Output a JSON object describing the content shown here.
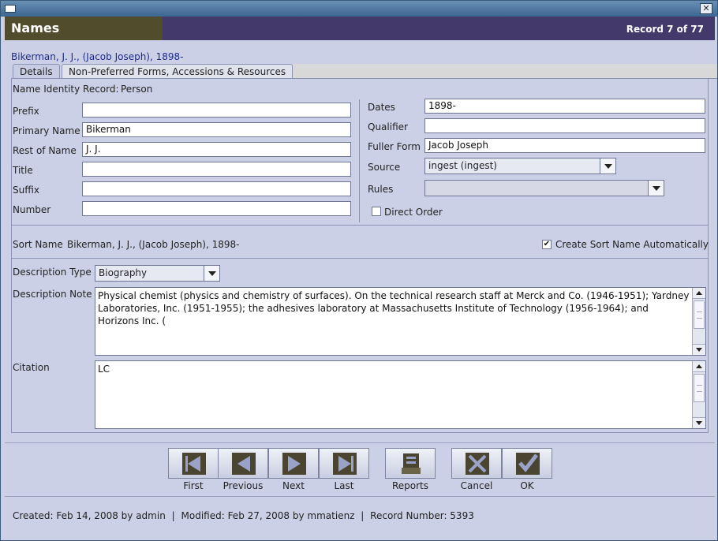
{
  "window": {
    "close_glyph": "✕"
  },
  "header": {
    "title": "Names",
    "record": "Record 7 of 77"
  },
  "record_heading": "Bikerman, J. J.,  (Jacob Joseph), 1898-",
  "tabs": [
    {
      "label": "Details",
      "active": true
    },
    {
      "label": "Non-Preferred Forms, Accessions & Resources",
      "active": false
    }
  ],
  "identity": {
    "label": "Name Identity Record:",
    "value": "Person"
  },
  "left_fields": {
    "prefix": {
      "label": "Prefix",
      "value": ""
    },
    "primary_name": {
      "label": "Primary Name",
      "value": "Bikerman"
    },
    "rest_of_name": {
      "label": "Rest of Name",
      "value": "J. J."
    },
    "title": {
      "label": "Title",
      "value": ""
    },
    "suffix": {
      "label": "Suffix",
      "value": ""
    },
    "number": {
      "label": "Number",
      "value": ""
    }
  },
  "right_fields": {
    "dates": {
      "label": "Dates",
      "value": "1898-"
    },
    "qualifier": {
      "label": "Qualifier",
      "value": ""
    },
    "fuller_form": {
      "label": "Fuller Form",
      "value": "Jacob Joseph"
    },
    "source": {
      "label": "Source",
      "value": "ingest (ingest)"
    },
    "rules": {
      "label": "Rules",
      "value": ""
    },
    "direct_order": {
      "label": "Direct Order",
      "checked": false
    }
  },
  "sort_name": {
    "label": "Sort Name",
    "value": "Bikerman, J. J.,  (Jacob Joseph), 1898-",
    "auto_label": "Create Sort Name Automatically",
    "auto_checked": true,
    "check_glyph": "✔"
  },
  "description_type": {
    "label": "Description Type",
    "value": "Biography"
  },
  "description_note": {
    "label": "Description Note",
    "value": "Physical chemist (physics and chemistry of surfaces).  On the technical research staff at Merck and Co. (1946-1951); Yardney Laboratories, Inc. (1951-1955); the adhesives laboratory at Massachusetts Institute of Technology (1956-1964); and Horizons Inc. ("
  },
  "citation": {
    "label": "Citation",
    "value": "LC"
  },
  "buttons": {
    "first": "First",
    "previous": "Previous",
    "next": "Next",
    "last": "Last",
    "reports": "Reports",
    "cancel": "Cancel",
    "ok": "OK"
  },
  "icons": {
    "first": "first-record-icon",
    "previous": "previous-record-icon",
    "next": "next-record-icon",
    "last": "last-record-icon",
    "reports": "reports-icon",
    "cancel": "cancel-icon",
    "ok": "ok-check-icon"
  },
  "colors": {
    "header_bg": "#433a6b",
    "header_accent": "#504c2c",
    "window_bg": "#ccd0e6",
    "heading_text": "#1c2a8c",
    "icon_fill": "#4a4530",
    "icon_light": "#9aa2c8"
  },
  "status": {
    "created": "Created: Feb 14, 2008 by admin",
    "modified": "Modified: Feb 27, 2008 by mmatienz",
    "record_number": "Record Number: 5393",
    "separator": "|"
  }
}
